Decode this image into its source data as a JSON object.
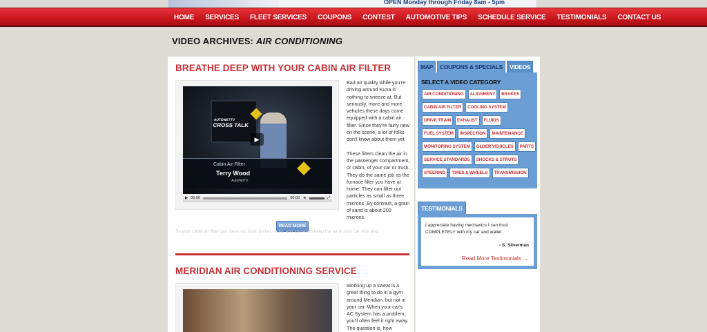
{
  "header": {
    "hours": "OPEN  Monday through Friday 8am - 5pm"
  },
  "nav": {
    "items": [
      "HOME",
      "SERVICES",
      "FLEET SERVICES",
      "COUPONS",
      "CONTEST",
      "AUTOMOTIVE TIPS",
      "SCHEDULE SERVICE",
      "TESTIMONIALS",
      "CONTACT US"
    ]
  },
  "page": {
    "title_prefix": "VIDEO ARCHIVES: ",
    "title_category": "AIR CONDITIONING"
  },
  "posts": [
    {
      "title": "BREATHE DEEP WITH YOUR CABIN AIR FILTER",
      "video": {
        "logo_line1": "AUTONETTV",
        "logo_line2": "CROSS TALK",
        "category": "Cabin Air Filter",
        "name": "Terry Wood",
        "brand": "AutoNetTV",
        "time_current": "00:00",
        "time_total": "00:00"
      },
      "paragraphs": [
        "Bad air quality while you're driving around Kuna is nothing to sneeze at. But seriously, more and more vehicles these days come equipped with a cabin air filter. Since they're fairly new on the scene, a lot of folks don't know about them yet.",
        "These filters clean the air in the passenger compartment, or cabin, of your car or truck. They do the same job as the furnace filter you have at home. They can filter out particles as small as three microns. By contrast, a grain of sand is about 200 microns."
      ],
      "read_more": "READ MORE",
      "excerpt": "So your cabin air filter can clean out dust, pollen, mold, and spores to keep the air in your car nice and"
    },
    {
      "title": "MERIDIAN AIR CONDITIONING SERVICE",
      "paragraphs": [
        "Working up a sweat is a great thing to do in a gym around Meridian, but not in your car. When your car's AC System has a problem, you'll often feel it right away. The question is, how"
      ]
    }
  ],
  "sidebar": {
    "tabs": [
      "MAP",
      "COUPONS & SPECIALS",
      "VIDEOS"
    ],
    "active_tab": "VIDEOS",
    "category_heading": "SELECT A VIDEO CATEGORY",
    "categories": [
      "AIR CONDITIONING",
      "ALIGNMENT",
      "BRAKES",
      "CABIN AIR FILTER",
      "COOLING SYSTEM",
      "DRIVE TRAIN",
      "EXHAUST",
      "FLUIDS",
      "FUEL SYSTEM",
      "INSPECTION",
      "MAINTENANCE",
      "MONITORING SYSTEM",
      "OLDER VEHICLES",
      "PARTS",
      "SERVICE STANDARDS",
      "SHOCKS & STRUTS",
      "STEERING",
      "TIRES & WHEELS",
      "TRANSMISSION"
    ],
    "testimonials": {
      "tab": "TESTIMONIALS",
      "quote": "I appreciate having mechanics I can trust COMPLETELY with my car and wallet",
      "author": "- S. Silverman",
      "link": "Read More Testimonials →"
    }
  }
}
